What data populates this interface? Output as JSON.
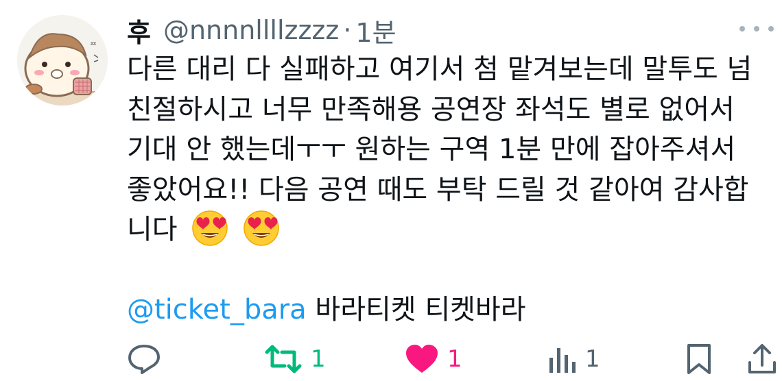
{
  "tweet": {
    "display_name": "후",
    "handle": "@nnnnllllzzzz",
    "separator": "·",
    "time": "1분",
    "body_lines": [
      "다른 대리 다 실패하고 여기서 첨 맡겨보는데 말투도 넘",
      "친절하시고 너무 만족해용  공연장 좌석도 별로 없어서",
      "기대 안 했는데ㅜㅜ 원하는 구역 1분 만에 잡아주셔서",
      "좋았어요!! 다음 공연 때도 부탁 드릴 것 같아여 감사합",
      "니다"
    ],
    "emojis": [
      "smiling-face-with-heart-eyes",
      "smiling-face-with-heart-eyes"
    ],
    "mention": "@ticket_bara",
    "mention_suffix": " 바라티켓 티켓바라"
  },
  "actions": {
    "reply_icon": "reply-icon",
    "retweet_icon": "retweet-icon",
    "retweet_count": "1",
    "like_icon": "heart-icon",
    "like_count": "1",
    "views_icon": "views-icon",
    "views_count": "1",
    "bookmark_icon": "bookmark-icon",
    "share_icon": "share-icon"
  },
  "colors": {
    "text": "#0f1419",
    "secondary": "#536471",
    "mention": "#1d9bf0",
    "retweet": "#00ba7c",
    "like": "#f91880"
  }
}
